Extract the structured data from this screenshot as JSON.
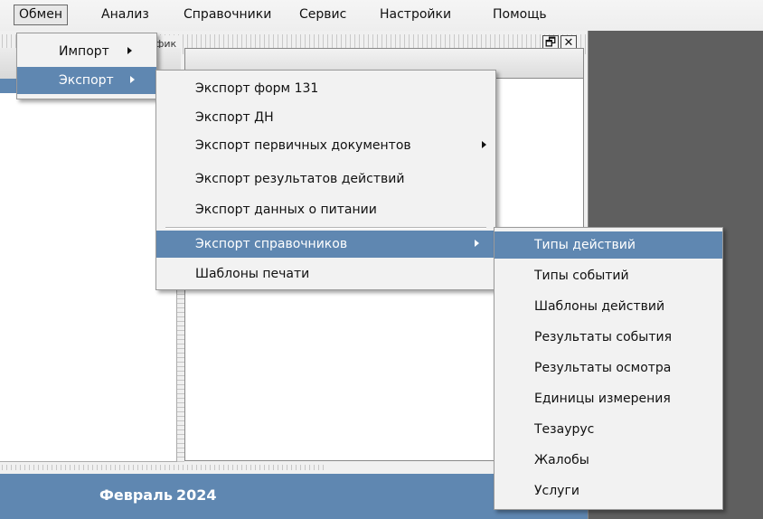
{
  "menubar": {
    "items": [
      {
        "label": "Обмен"
      },
      {
        "label": "Анализ"
      },
      {
        "label": "Справочники"
      },
      {
        "label": "Сервис"
      },
      {
        "label": "Настройки"
      },
      {
        "label": "Помощь"
      }
    ]
  },
  "window": {
    "title": "фик"
  },
  "footer": {
    "month": "Февраль",
    "year": "2024"
  },
  "menu_exchange": {
    "items": [
      {
        "label": "Импорт"
      },
      {
        "label": "Экспорт"
      }
    ]
  },
  "menu_export": {
    "items": [
      {
        "label": "Экспорт форм 131"
      },
      {
        "label": "Экспорт ДН"
      },
      {
        "label": "Экспорт первичных документов"
      },
      {
        "label": "Экспорт результатов действий"
      },
      {
        "label": "Экспорт данных о питании"
      },
      {
        "label": "Экспорт справочников"
      },
      {
        "label": "Шаблоны печати"
      }
    ]
  },
  "menu_dictionaries": {
    "items": [
      {
        "label": "Типы действий"
      },
      {
        "label": "Типы событий"
      },
      {
        "label": "Шаблоны действий"
      },
      {
        "label": "Результаты события"
      },
      {
        "label": "Результаты осмотра"
      },
      {
        "label": "Единицы измерения"
      },
      {
        "label": "Тезаурус"
      },
      {
        "label": "Жалобы"
      },
      {
        "label": "Услуги"
      }
    ]
  },
  "colors": {
    "highlight": "#5f87b1",
    "menu_bg": "#f2f2f2",
    "dark_panel": "#5f5f5f"
  },
  "icons": {
    "submenu": "chevron-right-icon",
    "restore": "restore-window-icon",
    "close": "close-icon"
  }
}
